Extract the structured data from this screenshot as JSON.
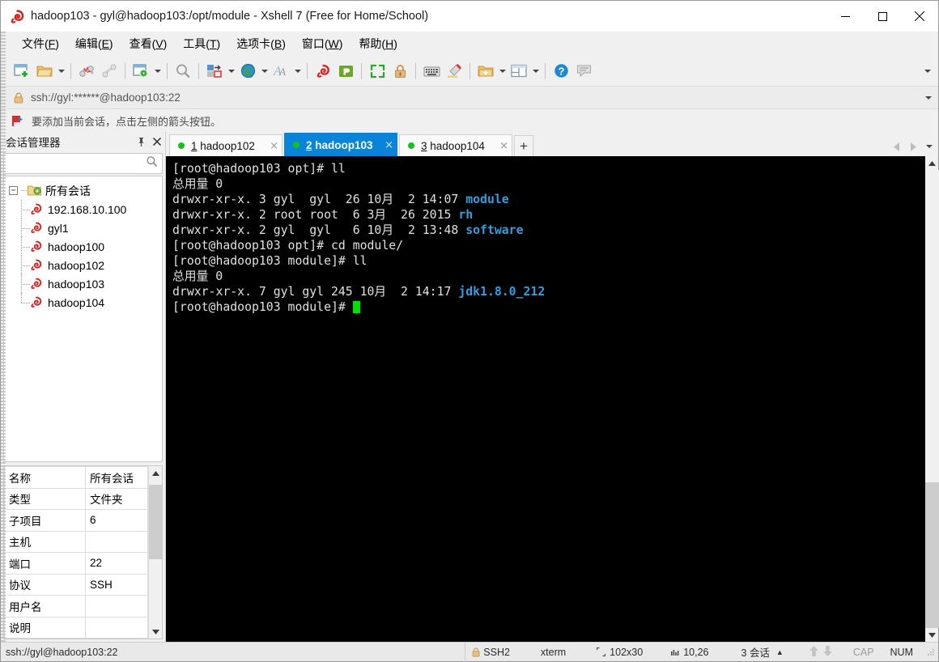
{
  "window": {
    "title": "hadoop103 - gyl@hadoop103:/opt/module - Xshell 7 (Free for Home/School)",
    "app_icon": "xshell-logo-icon",
    "minimize_label": "–",
    "maximize_label": "□",
    "close_label": "×"
  },
  "menubar": {
    "items": [
      {
        "label": "文件",
        "accel": "F"
      },
      {
        "label": "编辑",
        "accel": "E"
      },
      {
        "label": "查看",
        "accel": "V"
      },
      {
        "label": "工具",
        "accel": "T"
      },
      {
        "label": "选项卡",
        "accel": "B"
      },
      {
        "label": "窗口",
        "accel": "W"
      },
      {
        "label": "帮助",
        "accel": "H"
      }
    ]
  },
  "toolbar": {
    "buttons": [
      {
        "name": "new-session-icon",
        "has_caret": false
      },
      {
        "name": "open-folder-icon",
        "has_caret": true
      },
      {
        "sep": true
      },
      {
        "name": "disconnect-icon",
        "has_caret": false
      },
      {
        "name": "reconnect-icon",
        "has_caret": false
      },
      {
        "sep": true
      },
      {
        "name": "session-properties-icon",
        "has_caret": true
      },
      {
        "sep": true
      },
      {
        "name": "find-icon",
        "has_caret": false
      },
      {
        "sep": true
      },
      {
        "name": "transfer-file-icon",
        "has_caret": true
      },
      {
        "name": "globe-icon",
        "has_caret": true
      },
      {
        "name": "font-icon",
        "has_caret": true
      },
      {
        "sep": true
      },
      {
        "name": "xshell-icon",
        "has_caret": false
      },
      {
        "name": "xftp-icon",
        "has_caret": false
      },
      {
        "sep": true
      },
      {
        "name": "fullscreen-icon",
        "has_caret": false
      },
      {
        "name": "lock-icon",
        "has_caret": false
      },
      {
        "sep": true
      },
      {
        "name": "keyboard-icon",
        "has_caret": false
      },
      {
        "name": "highlight-icon",
        "has_caret": false
      },
      {
        "sep": true
      },
      {
        "name": "add-folder-icon",
        "has_caret": true
      },
      {
        "name": "layout-icon",
        "has_caret": true
      },
      {
        "sep": true
      },
      {
        "name": "help-icon",
        "has_caret": false
      },
      {
        "name": "comment-icon",
        "has_caret": false
      }
    ],
    "overflow_label": "toolbar-overflow-icon"
  },
  "addressbar": {
    "icon": "lock-icon",
    "url": "ssh://gyl:******@hadoop103:22",
    "dropdown_icon": "chevron-down-icon"
  },
  "noticebar": {
    "icon": "red-flag-arrow-icon",
    "text": "要添加当前会话，点击左侧的箭头按钮。"
  },
  "sidebar": {
    "title": "会话管理器",
    "pin_icon": "pin-icon",
    "close_icon": "close-icon",
    "search_placeholder": "",
    "search_icon": "search-icon",
    "tree": {
      "root": {
        "label": "所有会话",
        "icon": "folder-sessions-icon",
        "expander": "−"
      },
      "children": [
        {
          "label": "192.168.10.100",
          "icon": "session-icon"
        },
        {
          "label": "gyl1",
          "icon": "session-icon"
        },
        {
          "label": "hadoop100",
          "icon": "session-icon"
        },
        {
          "label": "hadoop102",
          "icon": "session-icon"
        },
        {
          "label": "hadoop103",
          "icon": "session-icon"
        },
        {
          "label": "hadoop104",
          "icon": "session-icon"
        }
      ]
    },
    "properties": [
      {
        "key": "名称",
        "value": "所有会话"
      },
      {
        "key": "类型",
        "value": "文件夹"
      },
      {
        "key": "子项目",
        "value": "6"
      },
      {
        "key": "主机",
        "value": ""
      },
      {
        "key": "端口",
        "value": "22"
      },
      {
        "key": "协议",
        "value": "SSH"
      },
      {
        "key": "用户名",
        "value": ""
      },
      {
        "key": "说明",
        "value": ""
      }
    ]
  },
  "tabs": {
    "items": [
      {
        "index": "1",
        "label": "hadoop102",
        "active": false,
        "connected": true,
        "close": "×"
      },
      {
        "index": "2",
        "label": "hadoop103",
        "active": true,
        "connected": true,
        "close": "×"
      },
      {
        "index": "3",
        "label": "hadoop104",
        "active": false,
        "connected": true,
        "close": "×"
      }
    ],
    "new_tab_label": "+",
    "prev_icon": "chevron-left-icon",
    "next_icon": "chevron-right-icon",
    "list_icon": "chevron-down-icon"
  },
  "terminal": {
    "lines": [
      [
        {
          "t": "[root@hadoop103 opt]# ll",
          "c": "white"
        }
      ],
      [
        {
          "t": "总用量 0",
          "c": "white"
        }
      ],
      [
        {
          "t": "drwxr-xr-x. 3 gyl  gyl  26 10月  2 14:07 ",
          "c": "white"
        },
        {
          "t": "module",
          "c": "blue"
        }
      ],
      [
        {
          "t": "drwxr-xr-x. 2 root root  6 3月  26 2015 ",
          "c": "white"
        },
        {
          "t": "rh",
          "c": "blue"
        }
      ],
      [
        {
          "t": "drwxr-xr-x. 2 gyl  gyl   6 10月  2 13:48 ",
          "c": "white"
        },
        {
          "t": "software",
          "c": "blue"
        }
      ],
      [
        {
          "t": "[root@hadoop103 opt]# cd module/",
          "c": "white"
        }
      ],
      [
        {
          "t": "[root@hadoop103 module]# ll",
          "c": "white"
        }
      ],
      [
        {
          "t": "总用量 0",
          "c": "white"
        }
      ],
      [
        {
          "t": "drwxr-xr-x. 7 gyl gyl 245 10月  2 14:17 ",
          "c": "white"
        },
        {
          "t": "jdk1.8.0_212",
          "c": "blue"
        }
      ],
      [
        {
          "t": "[root@hadoop103 module]# ",
          "c": "white"
        },
        {
          "t": "",
          "c": "cursor"
        }
      ]
    ],
    "bg_color": "#000000",
    "fg_color": "#d9d9d9",
    "dir_color": "#2f9fe0",
    "cursor_color": "#00e000"
  },
  "statusbar": {
    "connection": "ssh://gyl@hadoop103:22",
    "security_icon": "lock-icon",
    "security": "SSH2",
    "terminal_type": "xterm",
    "size_icon": "screen-size-icon",
    "size": "102x30",
    "cursor_icon": "cursor-pos-icon",
    "cursor": "10,26",
    "sessions": "3 会话",
    "sessions_caret": "▲",
    "up_icon": "arrow-up-icon",
    "down_icon": "arrow-down-icon",
    "cap": "CAP",
    "num": "NUM",
    "resize_grip": "resize-grip-icon"
  }
}
